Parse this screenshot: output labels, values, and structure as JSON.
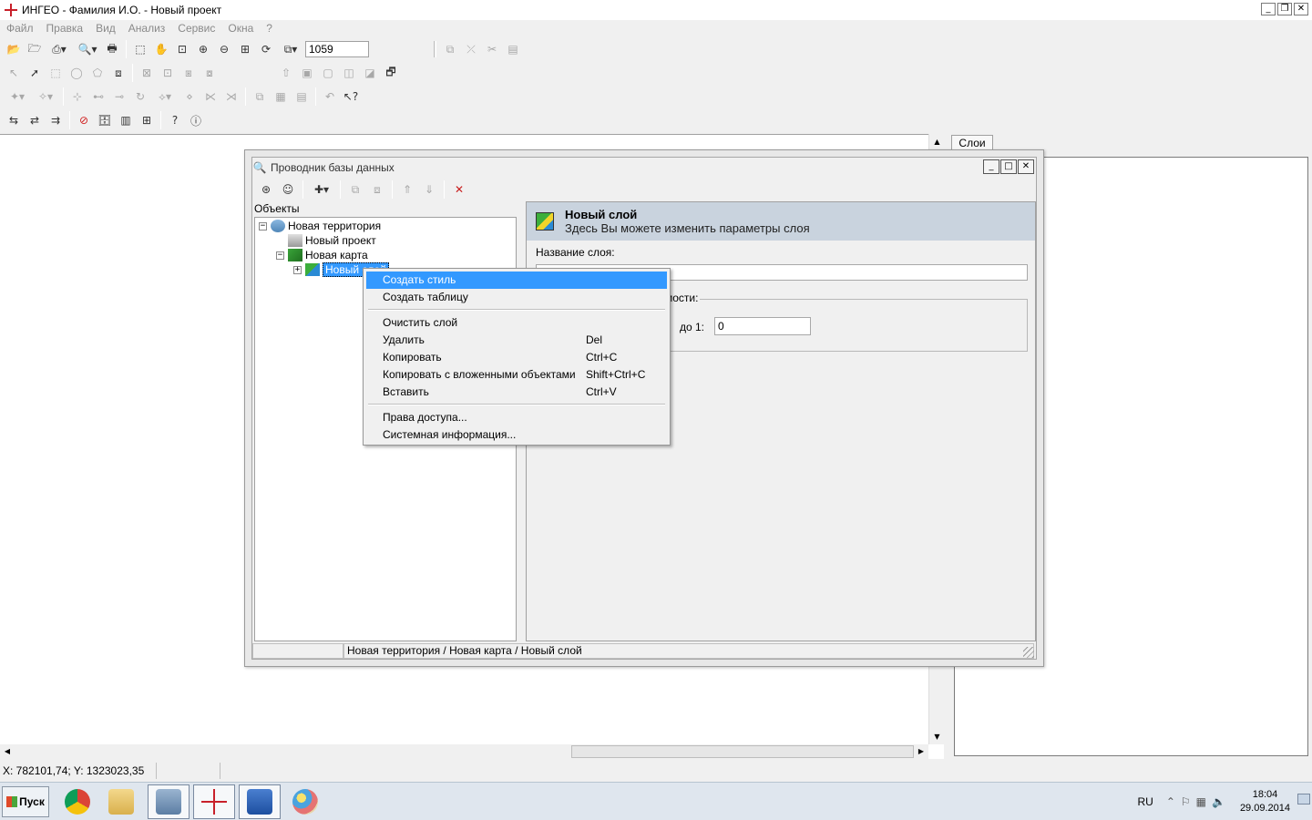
{
  "app": {
    "title": "ИНГЕО - Фамилия И.О. - Новый проект",
    "win_min": "_",
    "win_max": "❐",
    "win_close": "✕"
  },
  "menu": [
    "Файл",
    "Правка",
    "Вид",
    "Анализ",
    "Сервис",
    "Окна",
    "?"
  ],
  "toolbar": {
    "scale_value": "1059"
  },
  "layers_panel": {
    "tab_label": "Слои"
  },
  "status": {
    "coords": "X: 782101,74; Y: 1323023,35"
  },
  "dialog": {
    "title": "Проводник базы данных",
    "tree_header": "Объекты",
    "tree": [
      {
        "label": "Новая территория",
        "expander": "−"
      },
      {
        "label": "Новый проект",
        "expander": ""
      },
      {
        "label": "Новая карта",
        "expander": "−"
      },
      {
        "label": "Новый слой",
        "expander": "+"
      }
    ],
    "header_title": "Новый слой",
    "header_subtitle": "Здесь Вы можете изменить параметры слоя",
    "name_label": "Название слоя:",
    "group_label_partial": "мости:",
    "scale_to_label": "до 1:",
    "scale_to_value": "0",
    "path": "Новая территория / Новая карта / Новый слой"
  },
  "context_menu": {
    "items": [
      {
        "label": "Создать стиль",
        "shortcut": ""
      },
      {
        "label": "Создать таблицу",
        "shortcut": ""
      },
      {
        "label": "Очистить слой",
        "shortcut": ""
      },
      {
        "label": "Удалить",
        "shortcut": "Del"
      },
      {
        "label": "Копировать",
        "shortcut": "Ctrl+C"
      },
      {
        "label": "Копировать с вложенными объектами",
        "shortcut": "Shift+Ctrl+C"
      },
      {
        "label": "Вставить",
        "shortcut": "Ctrl+V"
      },
      {
        "label": "Права доступа...",
        "shortcut": ""
      },
      {
        "label": "Системная информация...",
        "shortcut": ""
      }
    ]
  },
  "taskbar": {
    "start_label": "Пуск",
    "lang": "RU",
    "time": "18:04",
    "date": "29.09.2014"
  },
  "colors": {
    "selection": "#3399ff",
    "header_band": "#c9d3de",
    "logo_red": "#c8202a"
  }
}
